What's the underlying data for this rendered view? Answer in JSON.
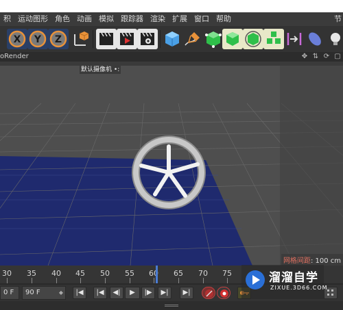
{
  "menubar": {
    "items": [
      "积",
      "运动图形",
      "角色",
      "动画",
      "模拟",
      "跟踪器",
      "渲染",
      "扩展",
      "窗口",
      "帮助"
    ],
    "right_item": "节"
  },
  "toolbar": {
    "axis_x_label": "X",
    "axis_y_label": "Y",
    "axis_z_label": "Z"
  },
  "viewport": {
    "panel_title": "oRender",
    "camera_label": "默认摄像机",
    "grid_info_label": "网格间距",
    "grid_info_value": ": 100 cm",
    "colors": {
      "background": "#4e4e4e",
      "floor": "#1f2a6e",
      "grid": "#6a6a6a"
    }
  },
  "timeline": {
    "ticks": [
      "30",
      "35",
      "40",
      "45",
      "50",
      "55",
      "60",
      "65",
      "70",
      "75"
    ],
    "current_frame_marker": "60"
  },
  "transport": {
    "start_field": "0 F",
    "end_field": "90 F",
    "buttons": {
      "go_start": "|◀",
      "prev_key": "|◀",
      "prev_frame": "◀|",
      "play": "▶",
      "next_frame": "|▶",
      "next_key": "▶|",
      "go_end": "▶|"
    }
  },
  "watermark": {
    "text": "溜溜自学",
    "url": "ZIXUE.3D66.COM"
  }
}
